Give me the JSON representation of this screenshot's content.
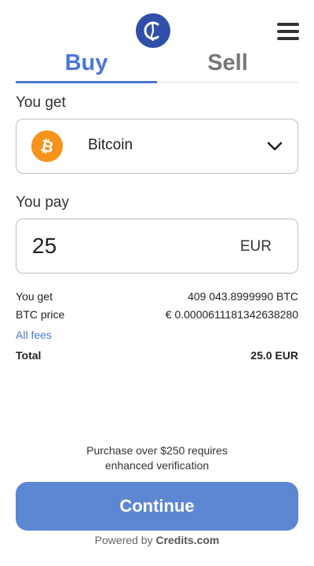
{
  "header": {
    "logo_icon": "credits-logo-icon",
    "menu_icon": "hamburger-menu-icon",
    "brand_color": "#2f4fa8"
  },
  "tabs": [
    {
      "label": "Buy",
      "active": true
    },
    {
      "label": "Sell",
      "active": false
    }
  ],
  "accent_color": "#4a78d0",
  "you_get": {
    "label": "You get",
    "selected_currency": "Bitcoin",
    "icon": "bitcoin-icon",
    "icon_color": "#f7931a"
  },
  "you_pay": {
    "label": "You pay",
    "value": "25",
    "currency": "EUR"
  },
  "summary": {
    "you_get_label": "You get",
    "you_get_value": "409 043.8999990 BTC",
    "btc_price_label": "BTC price",
    "btc_price_value": "€ 0.0000611181342638280",
    "fees_link": "All fees",
    "total_label": "Total",
    "total_value": "25.0 EUR"
  },
  "notice": {
    "line1": "Purchase over $250 requires",
    "line2": "enhanced verification"
  },
  "continue_button": {
    "label": "Continue",
    "color": "#5d87d3"
  },
  "footer": {
    "powered_by": "Powered by",
    "brand": "Credits.com"
  }
}
